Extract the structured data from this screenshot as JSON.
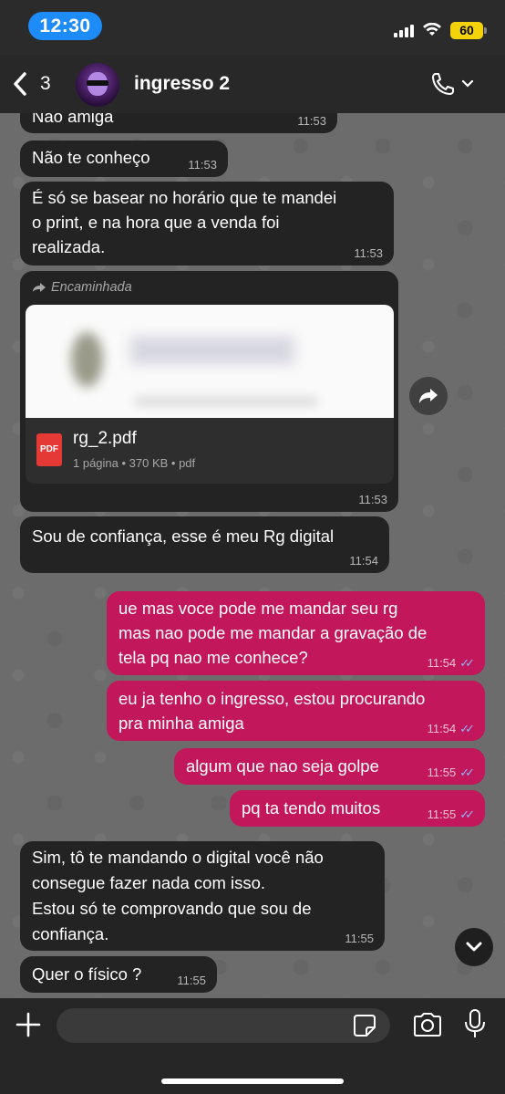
{
  "status_bar": {
    "time": "12:30",
    "battery": "60",
    "accent_color": "#1d8cf8",
    "battery_color": "#f5d20a"
  },
  "header": {
    "back_count": "3",
    "contact_name": "ingresso 2",
    "icons": [
      "chevron-left-icon",
      "phone-icon",
      "chevron-down-icon"
    ]
  },
  "messages": [
    {
      "dir": "in",
      "text": "Nao amiga",
      "time": "11:53"
    },
    {
      "dir": "in",
      "text": "Não te conheço",
      "time": "11:53"
    },
    {
      "dir": "in",
      "lines": [
        "É só se basear no horário que te mandei",
        "o print, e na hora que a venda foi",
        "realizada."
      ],
      "time": "11:53"
    },
    {
      "dir": "in",
      "type": "document",
      "forwarded_label": "Encaminhada",
      "file_name": "rg_2.pdf",
      "file_meta": "1 página • 370 KB • pdf",
      "file_icon_label": "PDF",
      "time": "11:53"
    },
    {
      "dir": "in",
      "text": "Sou de confiança, esse é meu Rg digital",
      "time": "11:54"
    },
    {
      "dir": "out",
      "lines": [
        "ue mas voce pode me mandar seu rg",
        "mas nao pode me mandar a gravação de",
        "tela pq nao me conhece?"
      ],
      "time": "11:54"
    },
    {
      "dir": "out",
      "lines": [
        "eu ja tenho o ingresso, estou procurando",
        "pra minha amiga"
      ],
      "time": "11:54"
    },
    {
      "dir": "out",
      "text": "algum que nao seja golpe",
      "time": "11:55"
    },
    {
      "dir": "out",
      "text": "pq ta tendo muitos",
      "time": "11:55"
    },
    {
      "dir": "in",
      "lines": [
        "Sim, tô te mandando o digital você não",
        "consegue fazer nada com isso.",
        "Estou só te comprovando que sou de",
        "confiança."
      ],
      "time": "11:55"
    },
    {
      "dir": "in",
      "text": "Quer o físico ?",
      "time": "11:55"
    }
  ],
  "composer": {
    "placeholder": "",
    "icons": [
      "plus-icon",
      "sticker-icon",
      "camera-icon",
      "microphone-icon"
    ]
  },
  "colors": {
    "incoming_bubble": "#232323",
    "outgoing_bubble": "#c2185b",
    "read_ticks": "#8fb4ff"
  }
}
